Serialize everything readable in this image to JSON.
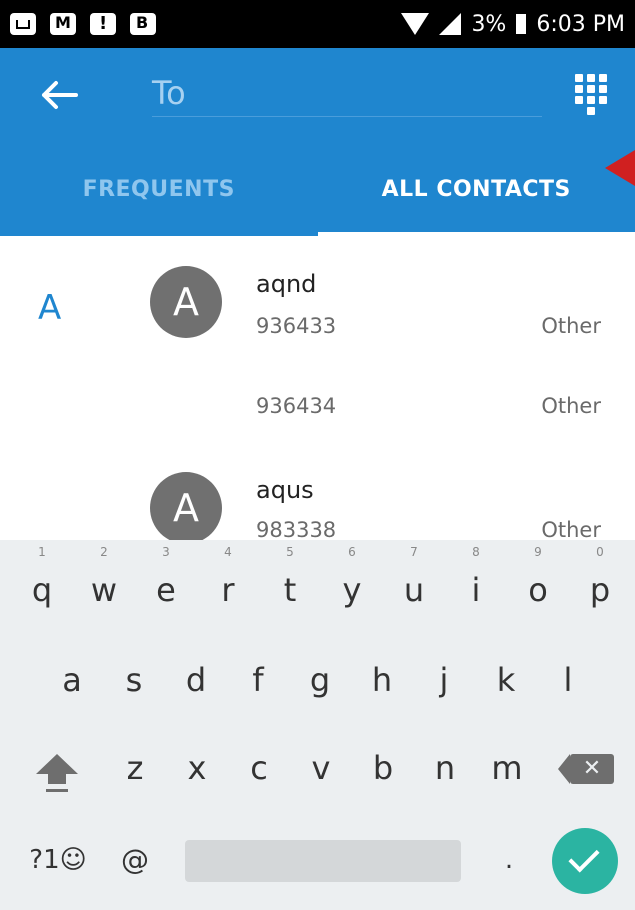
{
  "status_bar": {
    "icons": [
      "photo-icon",
      "gmail-icon",
      "alert-icon",
      "b-icon",
      "wifi-icon",
      "signal-icon",
      "battery-icon"
    ],
    "battery": "3%",
    "time": "6:03 PM"
  },
  "app_bar": {
    "to_placeholder": "To",
    "accent_color": "#1f86cf"
  },
  "tabs": [
    {
      "label": "FREQUENTS",
      "selected": false
    },
    {
      "label": "ALL CONTACTS",
      "selected": true
    }
  ],
  "contacts": {
    "section": "A",
    "entries": [
      {
        "avatar": "A",
        "name": "aqnd",
        "numbers": [
          {
            "number": "936433",
            "type": "Other"
          },
          {
            "number": "936434",
            "type": "Other"
          }
        ]
      },
      {
        "avatar": "A",
        "name": "aqus",
        "numbers": [
          {
            "number": "983338",
            "type": "Other"
          }
        ]
      }
    ]
  },
  "keyboard": {
    "row1": [
      "q",
      "w",
      "e",
      "r",
      "t",
      "y",
      "u",
      "i",
      "o",
      "p"
    ],
    "row1_hints": [
      "1",
      "2",
      "3",
      "4",
      "5",
      "6",
      "7",
      "8",
      "9",
      "0"
    ],
    "row2": [
      "a",
      "s",
      "d",
      "f",
      "g",
      "h",
      "j",
      "k",
      "l"
    ],
    "row3": [
      "z",
      "x",
      "c",
      "v",
      "b",
      "n",
      "m"
    ],
    "symbols_label": "?1☺",
    "at_label": "@",
    "period_label": ".",
    "backspace_glyph": "✕",
    "done_color": "#2bb4a2"
  }
}
